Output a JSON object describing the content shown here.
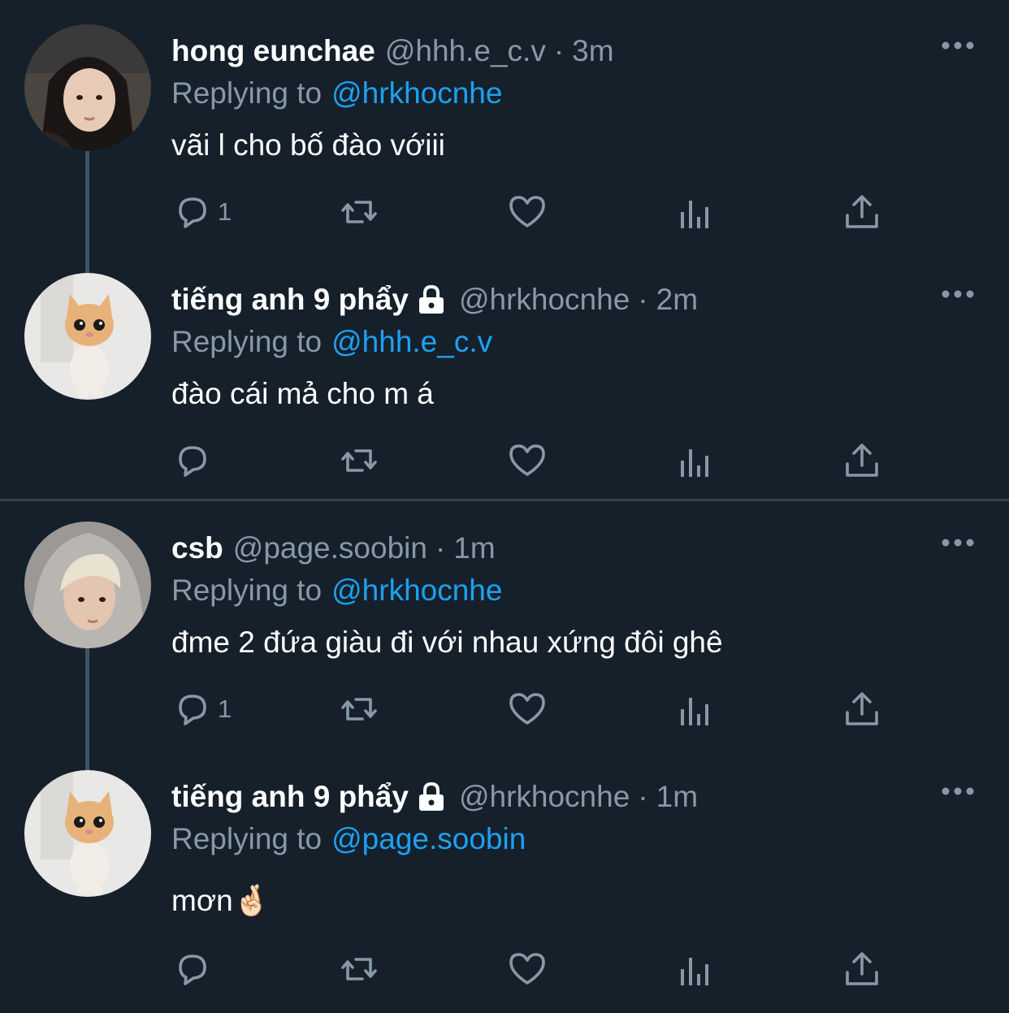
{
  "threads": [
    {
      "tweets": [
        {
          "display_name": "hong eunchae",
          "handle": "@hhh.e_c.v",
          "dot": "·",
          "time": "3m",
          "replying_label": "Replying to",
          "replying_handle": "@hrkhocnhe",
          "text": "vãi l cho bố đào vớiii",
          "reply_count": "1",
          "locked": false,
          "avatar": "girl-portrait"
        },
        {
          "display_name": "tiếng anh 9 phẩy",
          "handle": "@hrkhocnhe",
          "dot": "·",
          "time": "2m",
          "replying_label": "Replying to",
          "replying_handle": "@hhh.e_c.v",
          "text": "đào cái mả cho m á",
          "reply_count": "",
          "locked": true,
          "avatar": "kitten"
        }
      ]
    },
    {
      "tweets": [
        {
          "display_name": "csb",
          "handle": "@page.soobin",
          "dot": "·",
          "time": "1m",
          "replying_label": "Replying to",
          "replying_handle": "@hrkhocnhe",
          "text": "đme 2 đứa giàu đi với nhau xứng đôi ghê",
          "reply_count": "1",
          "locked": false,
          "avatar": "hooded-person"
        },
        {
          "display_name": "tiếng anh 9 phẩy",
          "handle": "@hrkhocnhe",
          "dot": "·",
          "time": "1m",
          "replying_label": "Replying to",
          "replying_handle": "@page.soobin",
          "text": "mơn🤞🏻",
          "reply_count": "",
          "locked": true,
          "avatar": "kitten"
        }
      ]
    }
  ],
  "icons": {
    "reply": "reply-icon",
    "retweet": "retweet-icon",
    "like": "heart-icon",
    "analytics": "analytics-icon",
    "share": "share-icon",
    "more": "more-icon",
    "lock": "lock-icon"
  },
  "colors": {
    "background": "#15202b",
    "secondary_text": "#8899a6",
    "link": "#1da1f2",
    "divider": "#38444d",
    "thread_line": "#3d5466"
  }
}
